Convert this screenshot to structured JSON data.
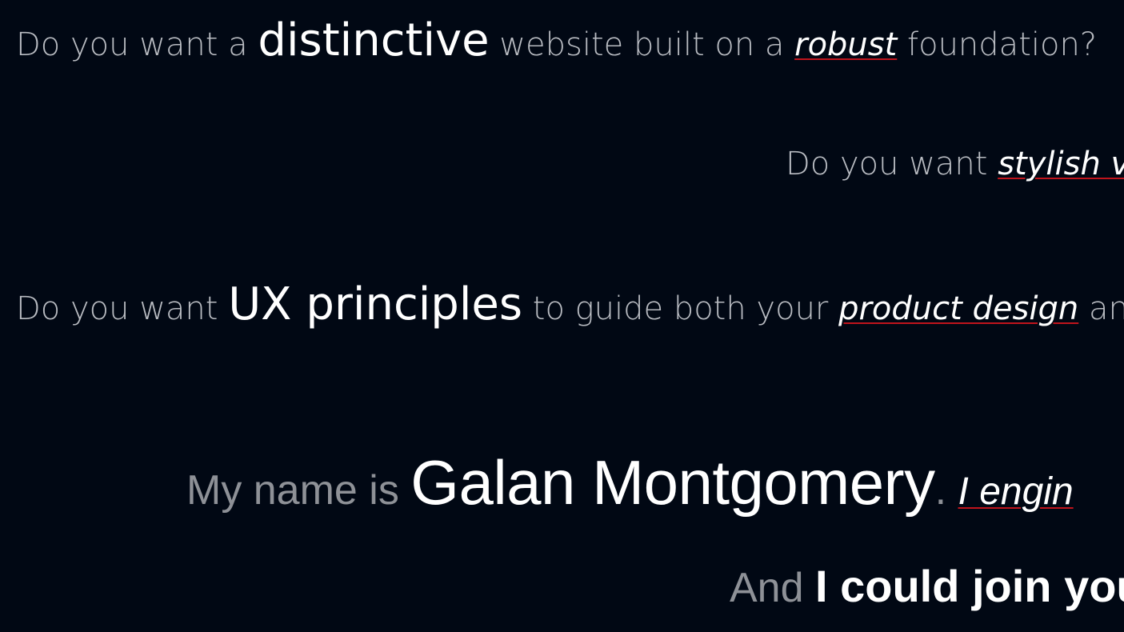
{
  "lines": [
    {
      "prefix": "Do you want a ",
      "emphasis": "distinctive",
      "middle": " website built on a ",
      "italic": "robust",
      "suffix": " foundation?"
    },
    {
      "prefix": "Do you want ",
      "italic": "stylish v"
    },
    {
      "prefix": "Do you want ",
      "emphasis": "UX principles",
      "middle": " to guide both your ",
      "italic": "product design",
      "suffix": " an"
    }
  ],
  "intro": {
    "prefix": "My name is ",
    "name": "Galan Montgomery",
    "dot": ".",
    "italic": "I engin"
  },
  "closing": {
    "prefix": "And ",
    "bold": "I could join you"
  },
  "colors": {
    "background": "#010814",
    "text_muted": "#b9bcc2",
    "text_emphasis": "#ffffff",
    "underline_accent": "#c0141c"
  }
}
